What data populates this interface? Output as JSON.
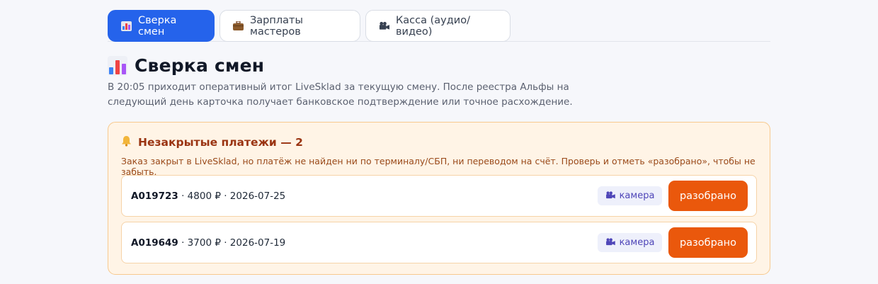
{
  "tabs": [
    {
      "icon": "bar-chart-icon",
      "label": "Сверка смен",
      "active": true
    },
    {
      "icon": "briefcase-icon",
      "label": "Зарплаты мастеров",
      "active": false
    },
    {
      "icon": "video-camera-icon",
      "label": "Касса (аудио/видео)",
      "active": false
    }
  ],
  "header": {
    "title": "Сверка смен",
    "description": "В 20:05 приходит оперативный итог LiveSklad за текущую смену. После реестра Альфы на следующий день карточка получает банковское подтверждение или точное расхождение."
  },
  "alert": {
    "title": "Незакрытые платежи — 2",
    "description": "Заказ закрыт в LiveSklad, но платёж не найден ни по терминалу/СБП, ни переводом на счёт. Проверь и отметь «разобрано», чтобы не забыть.",
    "rows": [
      {
        "order": "A019723",
        "details": " · 4800 ₽ · 2026-07-25",
        "camera_label": "камера",
        "done_label": "разобрано"
      },
      {
        "order": "A019649",
        "details": " · 3700 ₽ · 2026-07-19",
        "camera_label": "камера",
        "done_label": "разобрано"
      }
    ]
  },
  "colors": {
    "accent": "#2563eb",
    "warning_bg": "#fff4e6",
    "warning_border": "#f7c98e",
    "action": "#ea580c"
  }
}
